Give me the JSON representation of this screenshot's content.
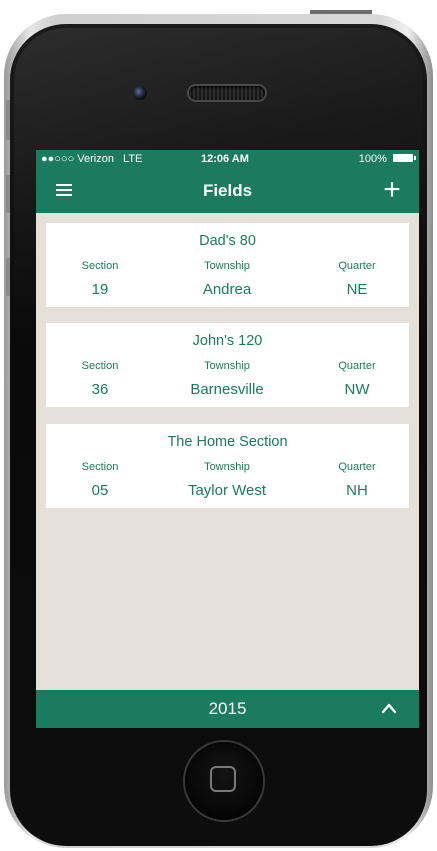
{
  "status_bar": {
    "carrier": "●●○○○ Verizon",
    "network": "LTE",
    "time": "12:06 AM",
    "battery": "100%"
  },
  "nav_bar": {
    "title": "Fields",
    "menu_icon": "hamburger-icon",
    "add_icon": "plus-icon"
  },
  "fields": [
    {
      "name": "Dad's 80",
      "section_label": "Section",
      "township_label": "Township",
      "quarter_label": "Quarter",
      "section": "19",
      "township": "Andrea",
      "quarter": "NE"
    },
    {
      "name": "John's 120",
      "section_label": "Section",
      "township_label": "Township",
      "quarter_label": "Quarter",
      "section": "36",
      "township": "Barnesville",
      "quarter": "NW"
    },
    {
      "name": "The Home Section",
      "section_label": "Section",
      "township_label": "Township",
      "quarter_label": "Quarter",
      "section": "05",
      "township": "Taylor West",
      "quarter": "NH"
    }
  ],
  "bottom_bar": {
    "year": "2015",
    "chevron_icon": "chevron-up-icon"
  },
  "colors": {
    "accent": "#1b7b5e",
    "screen_background": "#e6e0db",
    "card_background": "#ffffff"
  }
}
